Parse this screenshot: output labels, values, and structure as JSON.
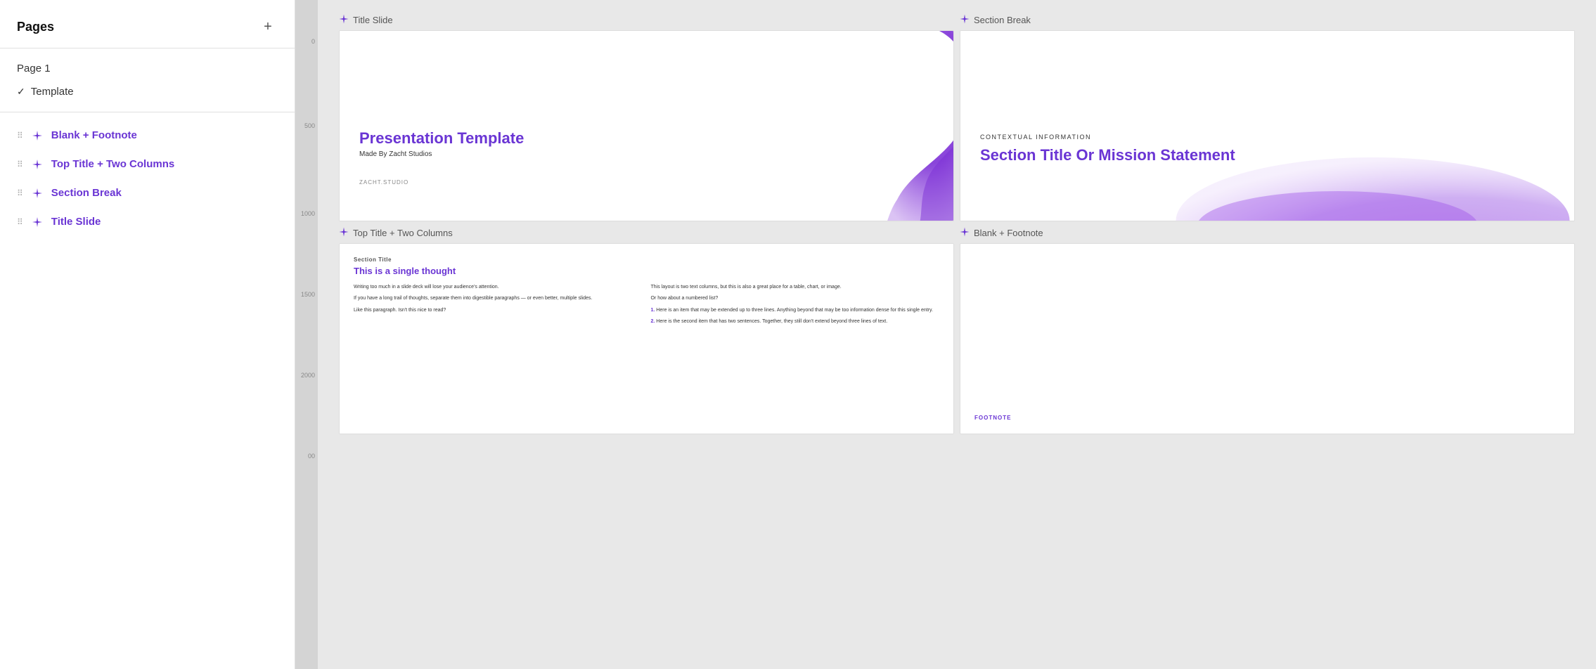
{
  "sidebar": {
    "title": "Pages",
    "add_button": "+",
    "pages": [
      {
        "label": "Page 1",
        "active": false
      },
      {
        "label": "Template",
        "active": true
      }
    ],
    "layouts": [
      {
        "label": "Blank + Footnote"
      },
      {
        "label": "Top Title + Two Columns"
      },
      {
        "label": "Section Break"
      },
      {
        "label": "Title Slide"
      }
    ]
  },
  "canvas": {
    "slides": [
      {
        "label": "Title Slide",
        "type": "title-slide",
        "main_title": "Presentation Template",
        "subtitle": "Made By Zacht Studios",
        "brand": "ZACHT.STUDIO"
      },
      {
        "label": "Section Break",
        "type": "section-break",
        "contextual": "CONTEXTUAL INFORMATION",
        "section_title": "Section Title Or Mission Statement"
      },
      {
        "label": "Top Title + Two Columns",
        "type": "two-columns",
        "section_label": "Section Title",
        "thought_title": "This is a single thought",
        "left_col": [
          "Writing too much in a slide deck will lose your audience's attention.",
          "If you have a long trail of thoughts, separate them into digestible paragraphs — or even better, multiple slides.",
          "Like this paragraph. Isn't this nice to read?"
        ],
        "right_col": [
          "This layout is two text columns, but this is also a great place for a table, chart, or image.",
          "Or how about a numbered list?",
          "1. Here is an item that may be extended up to three lines. Anything beyond that may be too information dense for this single entry.",
          "2. Here is the second item that has two sentences. Together, they still don't extend beyond three lines of text."
        ]
      },
      {
        "label": "Blank + Footnote",
        "type": "blank-footnote",
        "footnote": "FOOTNOTE"
      }
    ]
  },
  "colors": {
    "accent": "#6a35d4",
    "purple_light": "#b47fe8",
    "purple_mid": "#8b44e0"
  },
  "ruler_marks": [
    "0",
    "500",
    "1000",
    "1500",
    "2000",
    "00"
  ]
}
